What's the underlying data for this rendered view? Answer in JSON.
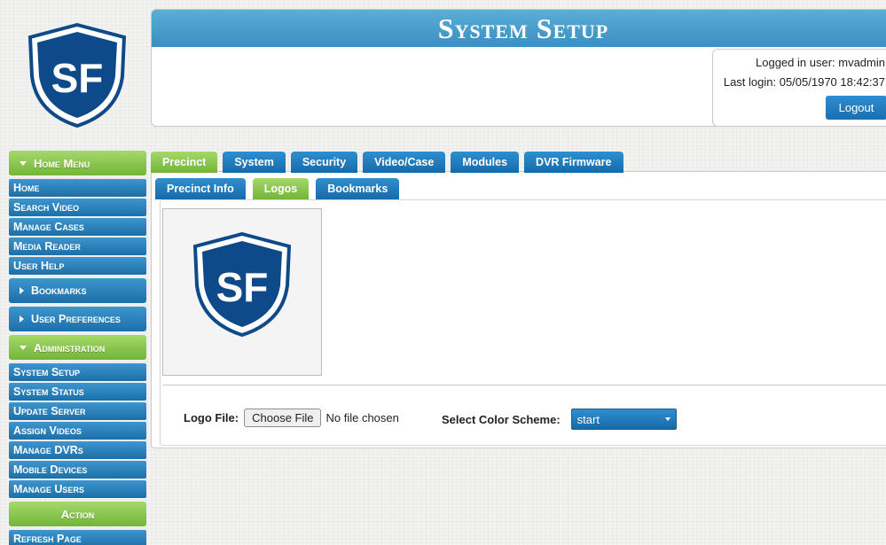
{
  "header": {
    "title": "System Setup",
    "logged_in": "Logged in user: mvadmin",
    "last_login": "Last login: 05/05/1970 18:42:37",
    "logout_label": "Logout"
  },
  "sidebar": {
    "home_menu": "Home Menu",
    "home_items": [
      "Home",
      "Search Video",
      "Manage Cases",
      "Media Reader",
      "User Help"
    ],
    "bookmarks": "Bookmarks",
    "user_preferences": "User Preferences",
    "administration": "Administration",
    "admin_items": [
      "System Setup",
      "System Status",
      "Update Server",
      "Assign Videos",
      "Manage DVRs",
      "Mobile Devices",
      "Manage Users"
    ],
    "action": "Action",
    "action_items": [
      "Refresh Page"
    ]
  },
  "tabs": {
    "top": [
      "Precinct",
      "System",
      "Security",
      "Video/Case",
      "Modules",
      "DVR Firmware"
    ],
    "sub": [
      "Precinct Info",
      "Logos",
      "Bookmarks"
    ],
    "active_top": "Precinct",
    "active_sub": "Logos"
  },
  "logo_form": {
    "file_label": "Logo File:",
    "file_button": "Choose File",
    "file_status": "No file chosen",
    "color_label": "Select Color Scheme:",
    "color_value": "start"
  },
  "logo": {
    "letters": "SF"
  },
  "colors": {
    "brand_blue": "#1c6fa8",
    "green": "#72b537",
    "shield_blue": "#0e4a8a"
  },
  "icons": [
    "shield-logo",
    "triangle-down-icon",
    "triangle-right-icon",
    "dropdown-caret-icon"
  ]
}
